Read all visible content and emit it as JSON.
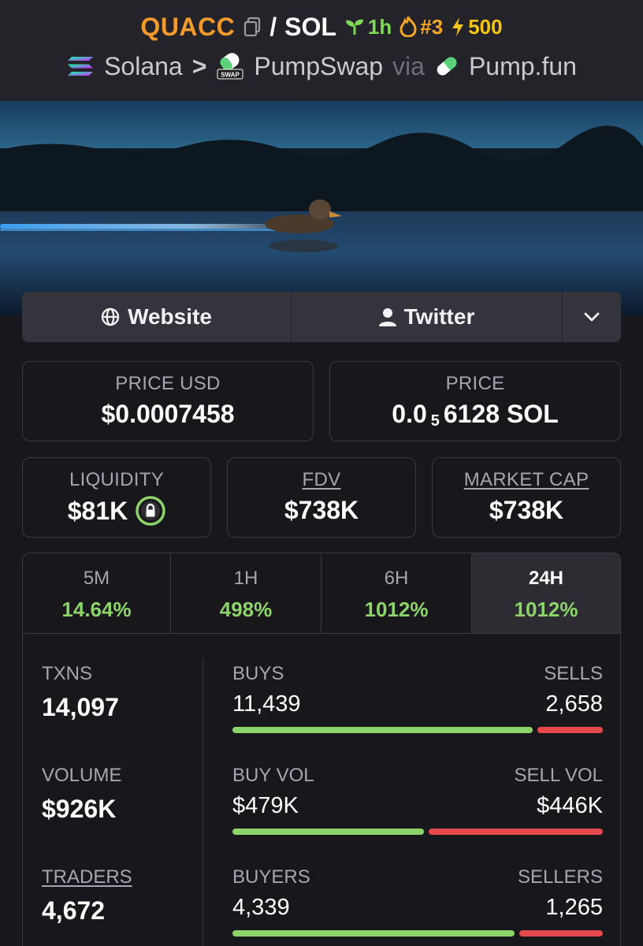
{
  "header": {
    "base_ticker": "QUACC",
    "slash": "/",
    "quote_ticker": "SOL",
    "age": "1h",
    "rank": "#3",
    "boost": "500",
    "chain": "Solana",
    "separator": ">",
    "dex": "PumpSwap",
    "via": "via",
    "launchpad": "Pump.fun",
    "accent_color": "#f39a2c"
  },
  "links": {
    "website": "Website",
    "twitter": "Twitter"
  },
  "price": {
    "usd_label": "PRICE USD",
    "usd_value": "$0.0007458",
    "native_label": "PRICE",
    "native_prefix": "0.0",
    "native_zeros": "5",
    "native_digits": "6128 SOL"
  },
  "metrics": {
    "liquidity_label": "LIQUIDITY",
    "liquidity_value": "$81K",
    "fdv_label": "FDV",
    "fdv_value": "$738K",
    "mcap_label": "MARKET CAP",
    "mcap_value": "$738K"
  },
  "timeframes": [
    {
      "label": "5M",
      "value": "14.64%"
    },
    {
      "label": "1H",
      "value": "498%"
    },
    {
      "label": "6H",
      "value": "1012%"
    },
    {
      "label": "24H",
      "value": "1012%"
    }
  ],
  "active_timeframe": "24H",
  "stats": {
    "txns_label": "TXNS",
    "txns_value": "14,097",
    "volume_label": "VOLUME",
    "volume_value": "$926K",
    "traders_label": "TRADERS",
    "traders_value": "4,672",
    "buys_label": "BUYS",
    "buys_value": "11,439",
    "sells_label": "SELLS",
    "sells_value": "2,658",
    "buy_vol_label": "BUY VOL",
    "buy_vol_value": "$479K",
    "sell_vol_label": "SELL VOL",
    "sell_vol_value": "$446K",
    "buyers_label": "BUYERS",
    "buyers_value": "4,339",
    "sellers_label": "SELLERS",
    "sellers_value": "1,265"
  },
  "colors": {
    "positive": "#8cd46a",
    "negative": "#e5484d",
    "background": "#18181c"
  }
}
